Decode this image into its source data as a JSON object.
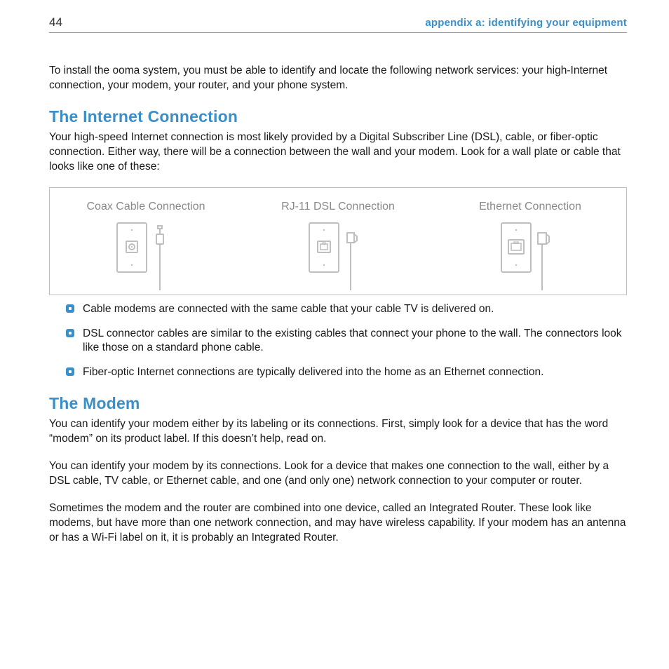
{
  "header": {
    "page_number": "44",
    "section_title": "appendix a: identifying your equipment"
  },
  "intro": "To install the ooma system, you must be able to identify and locate the following network services:  your high-Internet connection, your modem, your router, and your phone system.",
  "section1": {
    "title": "The Internet Connection",
    "para": "Your high-speed Internet connection is most likely provided by a Digital Subscriber Line (DSL), cable, or fiber-optic connection. Either way, there will be a connection between the wall and your modem. Look for a wall plate or cable that looks like one of these:",
    "connections": {
      "coax": "Coax Cable Connection",
      "rj11": "RJ-11 DSL Connection",
      "eth": "Ethernet Connection"
    },
    "bullets": [
      "Cable modems are connected with the same cable that your cable TV is delivered on.",
      "DSL connector cables are similar to the existing cables that connect your phone to the wall. The connectors look like those on a standard phone cable.",
      "Fiber-optic Internet connections are typically delivered into the home as an Ethernet connection."
    ]
  },
  "section2": {
    "title": "The Modem",
    "p1": "You can identify your modem either by its labeling or its connections. First, simply look for a device that has the word “modem” on its product label. If this doesn’t help, read on.",
    "p2": "You can identify your modem by its connections.  Look for a device that makes one connection to the wall, either by a DSL cable, TV cable, or Ethernet cable, and one (and only one) network connection to your computer or router.",
    "p3": "Sometimes the modem and the router are combined into one device, called an Integrated Router. These look like modems, but have more than one network connection, and may have wireless capability. If your modem has an antenna or has a Wi-Fi label on it, it is probably an Integrated Router."
  }
}
